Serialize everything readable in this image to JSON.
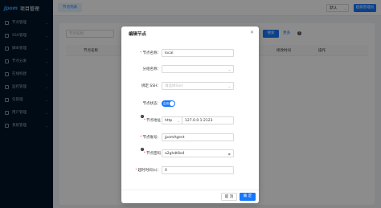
{
  "app": {
    "brand": "Jpom",
    "title": "项目管理"
  },
  "sidebar": {
    "items": [
      {
        "label": "节点管理",
        "icon": "node-icon"
      },
      {
        "label": "SSH管理",
        "icon": "ssh-icon"
      },
      {
        "label": "脚本管理",
        "icon": "script-icon"
      },
      {
        "label": "节点分发",
        "icon": "distribute-icon"
      },
      {
        "label": "在线构建",
        "icon": "build-icon"
      },
      {
        "label": "监控管理",
        "icon": "monitor-icon"
      },
      {
        "label": "包管理",
        "icon": "package-icon"
      },
      {
        "label": "用户管理",
        "icon": "user-icon"
      },
      {
        "label": "系统管理",
        "icon": "system-icon"
      }
    ]
  },
  "header": {
    "tab": "节点列表",
    "select_value": "默认",
    "user_button": "超级管理员"
  },
  "list": {
    "search_placeholder": "节点名称",
    "search_button": "搜索",
    "more_link": "更多",
    "columns": [
      "节点名称",
      "修改时间",
      "操作"
    ]
  },
  "modal": {
    "title": "编辑节点",
    "fields": {
      "name": {
        "label": "节点名称：",
        "value": "local"
      },
      "group": {
        "label": "分组名称：",
        "value": ""
      },
      "ssh": {
        "label": "绑定 SSH：",
        "placeholder": "请选择SSH"
      },
      "status": {
        "label": "节点状态：",
        "switch_text": "启用"
      },
      "address": {
        "label": "节点地址",
        "protocol": "http",
        "value": "127.0.0.1:2123"
      },
      "account": {
        "label": "节点账号：",
        "value": "jpomAgent"
      },
      "password": {
        "label": "节点密码",
        "value": "a2ghdt8o4"
      },
      "timeout": {
        "label": "超时时间(s)：",
        "value": "0"
      }
    },
    "cancel": "取 消",
    "ok": "确 定"
  }
}
